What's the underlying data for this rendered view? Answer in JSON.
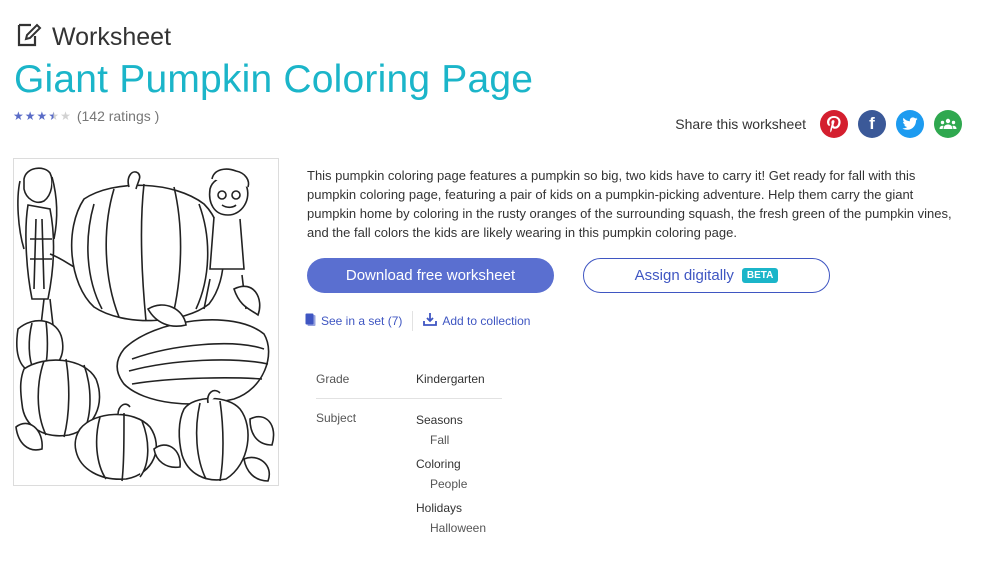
{
  "header": {
    "type_label": "Worksheet",
    "title": "Giant Pumpkin Coloring Page"
  },
  "rating": {
    "stars": 3.5,
    "max_stars": 5,
    "count_text": "(142 ratings )"
  },
  "share": {
    "label": "Share this worksheet",
    "icons": [
      "pinterest-icon",
      "facebook-icon",
      "twitter-icon",
      "google-classroom-icon"
    ],
    "colors": {
      "pinterest": "#d41f2f",
      "facebook": "#3b5998",
      "twitter": "#1d9bf0",
      "classroom": "#2fa84f"
    }
  },
  "description": "This pumpkin coloring page features a pumpkin so big, two kids have to carry it! Get ready for fall with this pumpkin coloring page, featuring a pair of kids on a pumpkin-picking adventure. Help them carry the giant pumpkin home by coloring in the rusty oranges of the surrounding squash, the fresh green of the pumpkin vines, and the fall colors the kids are likely wearing in this pumpkin coloring page.",
  "actions": {
    "download_label": "Download free worksheet",
    "assign_label": "Assign digitally",
    "assign_badge": "BETA",
    "see_in_set": "See in a set (7)",
    "add_to_collection": "Add to collection"
  },
  "meta": {
    "grade_key": "Grade",
    "grade_value": "Kindergarten",
    "subject_key": "Subject",
    "subjects": [
      {
        "name": "Seasons",
        "sub": "Fall"
      },
      {
        "name": "Coloring",
        "sub": "People"
      },
      {
        "name": "Holidays",
        "sub": "Halloween"
      }
    ]
  },
  "colors": {
    "title": "#1bb5c9",
    "primary_button": "#5a6fd0",
    "link": "#3f56c2",
    "star": "#5a6cc7"
  }
}
